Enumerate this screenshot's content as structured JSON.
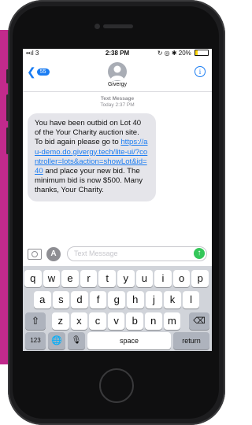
{
  "status_bar": {
    "carrier": "••ıl 3",
    "time": "2:38 PM",
    "indicators": "↻ ◎ ✱ 20%"
  },
  "nav": {
    "back_count": "55",
    "contact_name": "Givergy"
  },
  "thread": {
    "header_label": "Text Message",
    "header_date": "Today 2:37 PM"
  },
  "message": {
    "text_before": "You have been outbid on Lot 40 of the Your Charity auction site. To bid again please go to ",
    "link": "https://au-demo.do.givergy.tech/lite-ui/?controller=lots&action=showLot&id=40",
    "text_after": " and place your new bid. The minimum bid is now $500. Many thanks, Your Charity."
  },
  "composer": {
    "placeholder": "Text Message"
  },
  "keyboard": {
    "row1": [
      "q",
      "w",
      "e",
      "r",
      "t",
      "y",
      "u",
      "i",
      "o",
      "p"
    ],
    "row2": [
      "a",
      "s",
      "d",
      "f",
      "g",
      "h",
      "j",
      "k",
      "l"
    ],
    "row3": [
      "z",
      "x",
      "c",
      "v",
      "b",
      "n",
      "m"
    ],
    "numbers_label": "123",
    "space_label": "space",
    "return_label": "return"
  },
  "icons": {
    "shift": "shift-icon",
    "backspace": "backspace-icon",
    "globe": "globe-icon",
    "mic": "microphone-icon",
    "camera": "camera-icon",
    "appstore": "appstore-icon",
    "send": "send-arrow-icon",
    "info": "info-icon"
  },
  "colors": {
    "accent": "#1a7cf2",
    "bubble": "#e5e5ea",
    "send": "#34c759",
    "brand_card": "#c12a8c"
  }
}
